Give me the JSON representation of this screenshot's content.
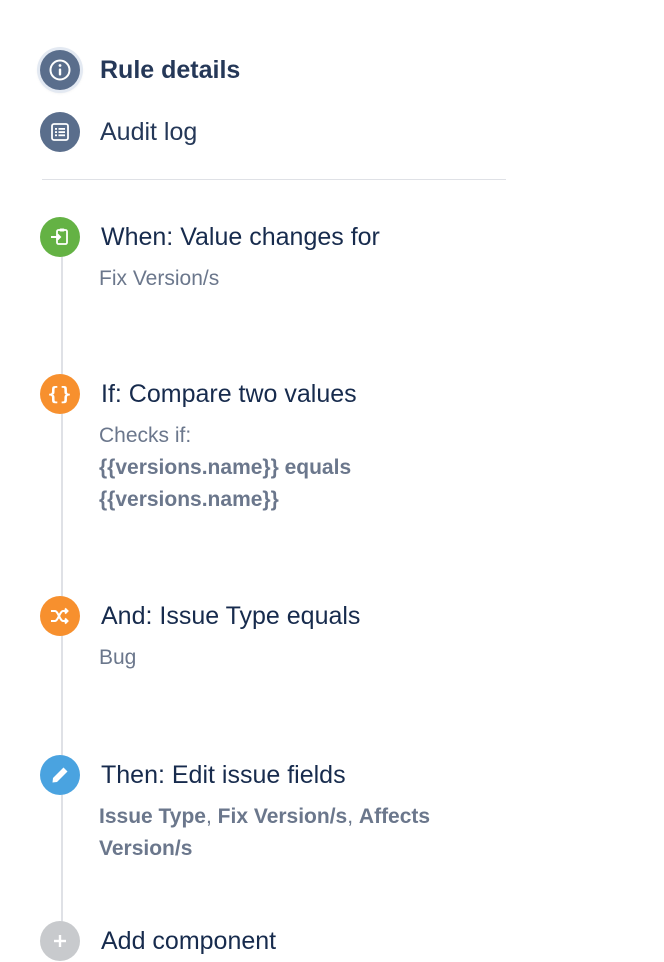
{
  "nav": {
    "rule_details_label": "Rule details",
    "audit_log_label": "Audit log"
  },
  "steps": {
    "when": {
      "title": "When: Value changes for",
      "desc": "Fix Version/s",
      "color": "#64b244",
      "icon": "trigger-icon"
    },
    "if": {
      "title": "If: Compare two values",
      "desc_prefix": "Checks if:",
      "desc_line1": "{{versions.name}} equals",
      "desc_line2": "{{versions.name}}",
      "color": "#f7902e",
      "icon": "braces-icon"
    },
    "and": {
      "title": "And: Issue Type equals",
      "desc": "Bug",
      "color": "#f7902e",
      "icon": "shuffle-icon"
    },
    "then": {
      "title": "Then: Edit issue fields",
      "field1": "Issue Type",
      "sep1": ", ",
      "field2": "Fix Version/s",
      "sep2": ", ",
      "field3_line1": "Affects",
      "field3_line2": "Version/s",
      "color": "#4aa3e0",
      "icon": "pencil-icon"
    }
  },
  "add_component": {
    "label": "Add component",
    "icon": "plus-icon"
  }
}
